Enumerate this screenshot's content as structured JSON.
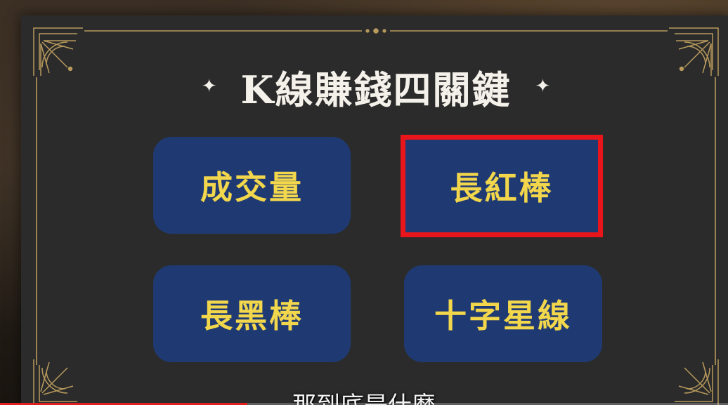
{
  "title": "K線賺錢四關鍵",
  "title_ornament_left": "✦",
  "title_ornament_right": "✦",
  "boxes": [
    {
      "label": "成交量",
      "highlighted": false
    },
    {
      "label": "長紅棒",
      "highlighted": true
    },
    {
      "label": "長黑棒",
      "highlighted": false
    },
    {
      "label": "十字星線",
      "highlighted": false
    }
  ],
  "subtitle": "那到底是什麼",
  "progress": 0.34,
  "colors": {
    "board": "#2b2b2b",
    "box_fill": "#1f3a73",
    "box_text": "#f2d64b",
    "title_text": "#f4f1ea",
    "highlight_border": "#e8151b",
    "ornament_gold": "#b79a5c",
    "progress": "#e02020"
  },
  "icons": {
    "corner_ornament": "art-deco-fan-icon",
    "sparkle": "four-point-star-icon"
  }
}
